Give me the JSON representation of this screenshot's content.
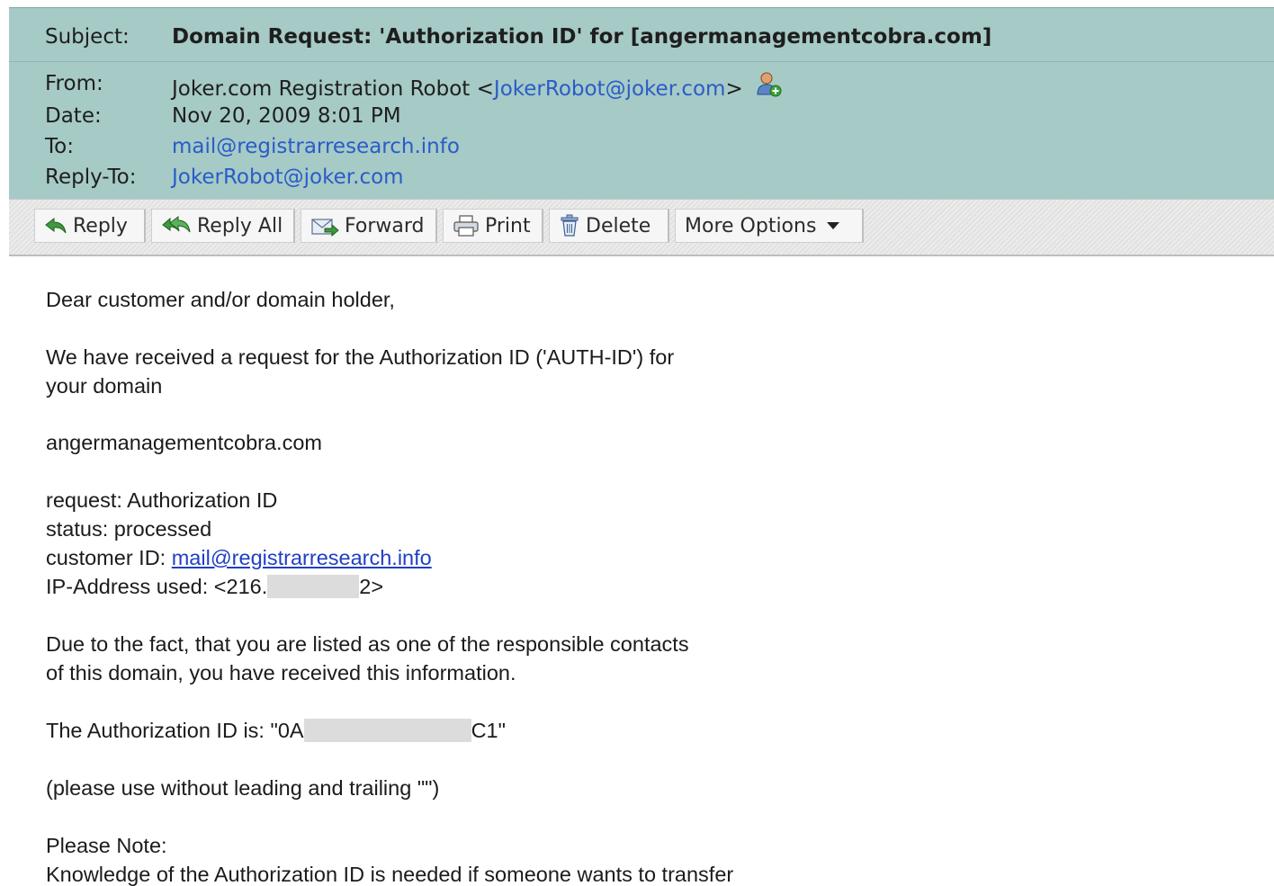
{
  "header": {
    "subject_label": "Subject:",
    "subject": "Domain Request: 'Authorization ID' for [angermanagementcobra.com]",
    "from_label": "From:",
    "from_name": "Joker.com Registration Robot <",
    "from_email": "JokerRobot@joker.com",
    "from_close": ">",
    "date_label": "Date:",
    "date": "Nov 20, 2009 8:01 PM",
    "to_label": "To:",
    "to": "mail@registrarresearch.info",
    "replyto_label": "Reply-To:",
    "replyto": "JokerRobot@joker.com"
  },
  "toolbar": {
    "reply": "Reply",
    "reply_all": "Reply All",
    "forward": "Forward",
    "print": "Print",
    "delete": "Delete",
    "more_options": "More Options"
  },
  "body": {
    "greeting": "Dear customer and/or domain holder,",
    "para1_line1": "We have received a request for the Authorization ID ('AUTH-ID') for",
    "para1_line2": "your domain",
    "domain": "angermanagementcobra.com",
    "request_line": "request: Authorization ID",
    "status_line": "status: processed",
    "customer_prefix": "customer ID: ",
    "customer_id": "mail@registrarresearch.info",
    "ip_prefix": "IP-Address used: <216.",
    "ip_suffix": "2>",
    "para2_line1": "Due to the fact, that you are listed as one of the responsible contacts",
    "para2_line2": "of this domain, you have received this information.",
    "auth_prefix": "The Authorization ID is: \"0A",
    "auth_suffix": "C1\"",
    "note_usage": "(please use without leading and trailing \"\")",
    "note_label": "Please Note:",
    "note_line1": "Knowledge of the Authorization ID is needed if someone wants to transfer"
  },
  "colors": {
    "header_bg": "#a6cac6",
    "link": "#2a5cc8",
    "body_link": "#1f3fc4"
  }
}
